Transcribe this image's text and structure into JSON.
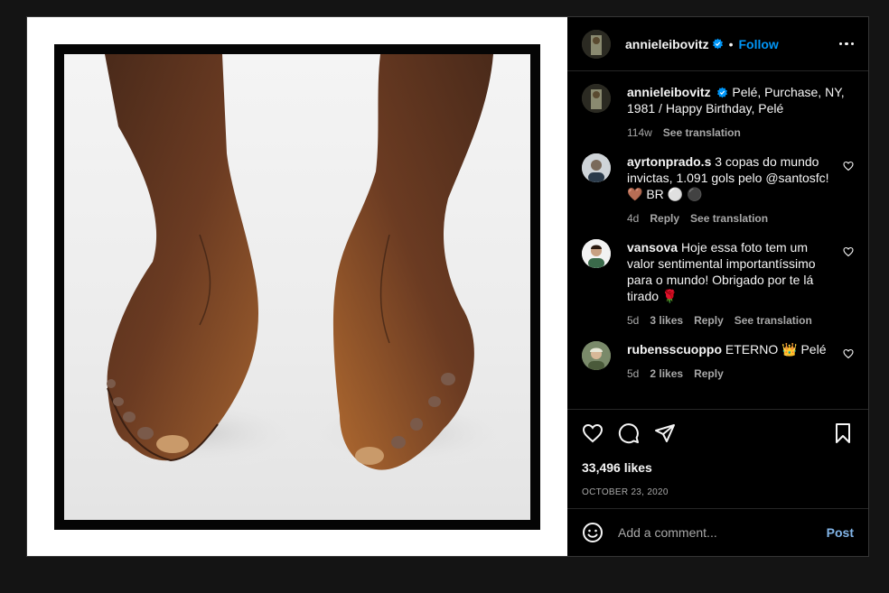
{
  "post": {
    "author": "annieleibovitz",
    "follow_label": "Follow",
    "dot": "•"
  },
  "caption": {
    "username": "annieleibovitz",
    "text": "Pelé, Purchase, NY, 1981 / Happy Birthday, Pelé",
    "time": "114w",
    "translation": "See translation"
  },
  "comments": [
    {
      "username": "ayrtonprado.s",
      "text": "3 copas do mundo invictas, 1.091 gols pelo @santosfc! 🤎 BR ⚪ ⚫",
      "time": "4d",
      "likes": "",
      "reply": "Reply",
      "translation": "See translation"
    },
    {
      "username": "vansova",
      "text": "Hoje essa foto tem um valor sentimental importantíssimo para o mundo! Obrigado por te lá tirado 🌹",
      "time": "5d",
      "likes": "3 likes",
      "reply": "Reply",
      "translation": "See translation"
    },
    {
      "username": "rubensscuoppo",
      "text": "ETERNO 👑 Pelé",
      "time": "5d",
      "likes": "2 likes",
      "reply": "Reply",
      "translation": ""
    }
  ],
  "engagement": {
    "likes": "33,496 likes",
    "date": "OCTOBER 23, 2020"
  },
  "composer": {
    "placeholder": "Add a comment...",
    "post_label": "Post"
  },
  "colors": {
    "accent": "#0095f6",
    "background": "#000000",
    "muted_text": "#a8a8a8"
  },
  "icons": [
    "heart-icon",
    "comment-icon",
    "share-icon",
    "bookmark-icon",
    "emoji-icon",
    "more-options-icon",
    "verified-badge-icon"
  ]
}
